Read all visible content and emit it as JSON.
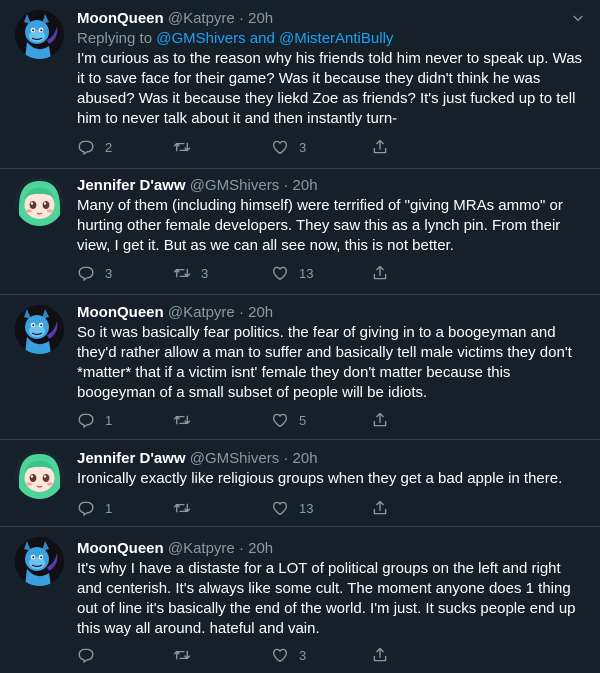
{
  "tweets": [
    {
      "name": "MoonQueen",
      "handle": "@Katpyre",
      "dot": "·",
      "time": "20h",
      "reply_prefix": "Replying to ",
      "reply_to": "@GMShivers and @MisterAntiBully",
      "text": "I'm curious as to the reason why his friends told him never to speak up. Was it to save face for their game? Was it because they didn't think he was abused? Was it because they liekd Zoe as friends? It's just fucked up to tell him to never talk about it and then instantly turn-",
      "replies": "2",
      "retweets": "",
      "likes": "3",
      "avatar": "blue-dragon"
    },
    {
      "name": "Jennifer D'aww",
      "handle": "@GMShivers",
      "dot": "·",
      "time": "20h",
      "text": "Many of them (including himself) were terrified of \"giving MRAs ammo\" or hurting other female developers. They saw this as a lynch pin. From their view, I get it. But as we can all see now, this is not better.",
      "replies": "3",
      "retweets": "3",
      "likes": "13",
      "avatar": "anime-girl"
    },
    {
      "name": "MoonQueen",
      "handle": "@Katpyre",
      "dot": "·",
      "time": "20h",
      "text": "So it was basically fear politics. the fear of giving in to a boogeyman and they'd rather allow a man to suffer and basically tell male victims they don't *matter* that if a victim isnt' female they don't matter because this boogeyman of a small subset of people will be idiots.",
      "replies": "1",
      "retweets": "",
      "likes": "5",
      "avatar": "blue-dragon"
    },
    {
      "name": "Jennifer D'aww",
      "handle": "@GMShivers",
      "dot": "·",
      "time": "20h",
      "text": "Ironically exactly like religious groups when they get a bad apple in there.",
      "replies": "1",
      "retweets": "",
      "likes": "13",
      "avatar": "anime-girl"
    },
    {
      "name": "MoonQueen",
      "handle": "@Katpyre",
      "dot": "·",
      "time": "20h",
      "text": "It's why I have a distaste for a LOT of political groups on the left and right and centerish. It's always like some cult. The moment anyone does 1 thing out of line it's basically the end of the world. I'm just. It sucks people end up this way all around. hateful and vain.",
      "replies": "",
      "retweets": "",
      "likes": "3",
      "avatar": "blue-dragon"
    }
  ],
  "colors": {
    "background": "#15202b",
    "secondary_text": "#8899a6",
    "link": "#1da1f2",
    "divider": "#38444d"
  },
  "icons": {
    "reply": "reply-icon",
    "retweet": "retweet-icon",
    "like": "heart-icon",
    "share": "share-icon",
    "more": "chevron-down-icon"
  }
}
